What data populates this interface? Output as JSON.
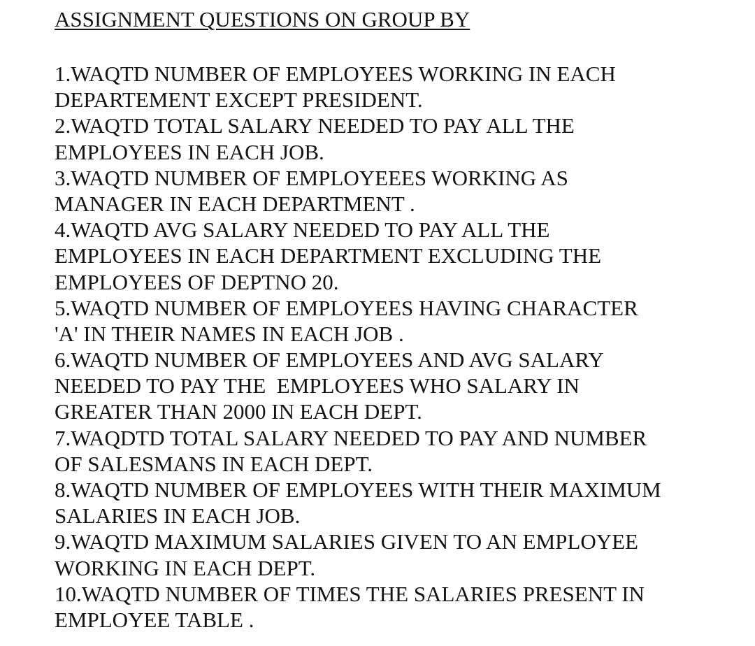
{
  "document": {
    "title": "ASSIGNMENT QUESTIONS ON GROUP BY",
    "questions": [
      {
        "lines": [
          "1.WAQTD NUMBER OF EMPLOYEES WORKING IN EACH",
          "DEPARTEMENT EXCEPT PRESIDENT."
        ]
      },
      {
        "lines": [
          "2.WAQTD TOTAL SALARY NEEDED TO PAY ALL THE",
          "EMPLOYEES IN EACH JOB."
        ]
      },
      {
        "lines": [
          "3.WAQTD NUMBER OF EMPLOYEEES WORKING AS",
          "MANAGER IN EACH DEPARTMENT ."
        ]
      },
      {
        "lines": [
          "4.WAQTD AVG SALARY NEEDED TO PAY ALL THE",
          "EMPLOYEES IN EACH DEPARTMENT EXCLUDING THE",
          "EMPLOYEES OF DEPTNO 20."
        ]
      },
      {
        "lines": [
          "5.WAQTD NUMBER OF EMPLOYEES HAVING CHARACTER",
          "'A' IN THEIR NAMES IN EACH JOB ."
        ]
      },
      {
        "lines": [
          "6.WAQTD NUMBER OF EMPLOYEES AND AVG SALARY",
          "NEEDED TO PAY THE  EMPLOYEES WHO SALARY IN",
          "GREATER THAN 2000 IN EACH DEPT."
        ]
      },
      {
        "lines": [
          "7.WAQDTD TOTAL SALARY NEEDED TO PAY AND NUMBER",
          "OF SALESMANS IN EACH DEPT."
        ]
      },
      {
        "lines": [
          "8.WAQTD NUMBER OF EMPLOYEES WITH THEIR MAXIMUM",
          "SALARIES IN EACH JOB."
        ]
      },
      {
        "lines": [
          "9.WAQTD MAXIMUM SALARIES GIVEN TO AN EMPLOYEE",
          "WORKING IN EACH DEPT."
        ]
      },
      {
        "lines": [
          "10.WAQTD NUMBER OF TIMES THE SALARIES PRESENT IN",
          "EMPLOYEE TABLE ."
        ]
      }
    ]
  }
}
